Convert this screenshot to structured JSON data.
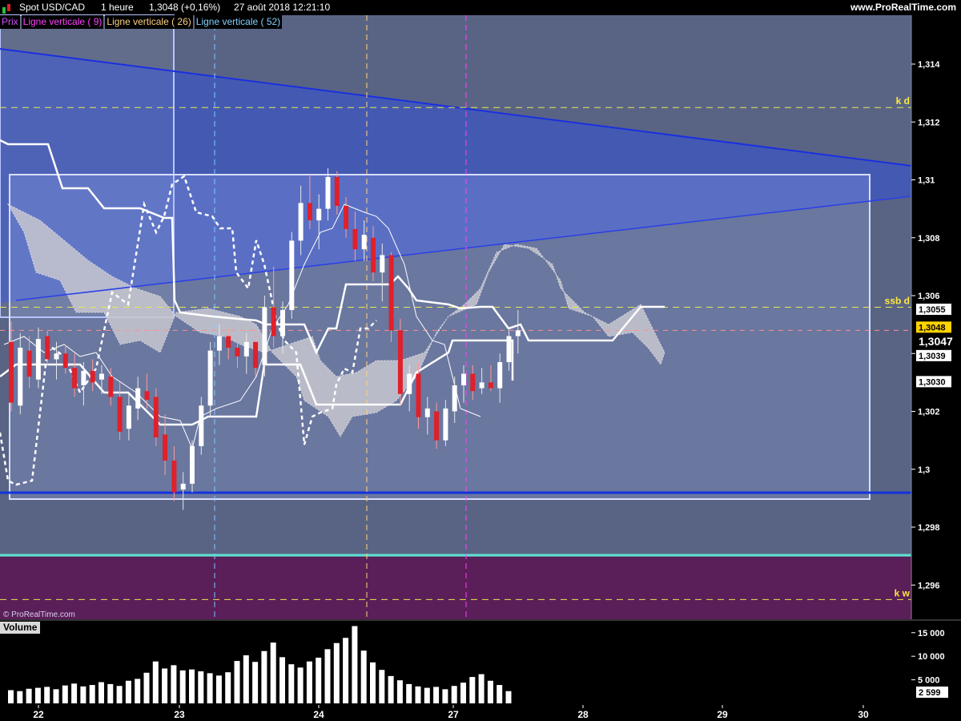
{
  "header": {
    "instrument": "Spot USD/CAD",
    "timeframe": "1 heure",
    "last_change": "1,3048 (+0,16%)",
    "datetime": "27 août 2018 12:21:10",
    "site": "www.ProRealTime.com"
  },
  "legend": [
    {
      "label": "Prix",
      "color": "#d050ff"
    },
    {
      "label": "Ligne verticale ( 9)",
      "color": "#ff40ff"
    },
    {
      "label": "Ligne verticale ( 26)",
      "color": "#ffd080"
    },
    {
      "label": "Ligne verticale ( 52)",
      "color": "#80d0ff"
    }
  ],
  "watermark": "© ProRealTime.com",
  "volume_panel": {
    "label": "Volume",
    "axis_labels": [
      "15 000",
      "10 000",
      "5 000",
      "2 599"
    ],
    "last_value_label": "2 599"
  },
  "price_labels": [
    {
      "text": "k d",
      "level": 1.3125
    },
    {
      "text": "ssb d",
      "level": 1.3056
    },
    {
      "text": "k w",
      "level": 1.2955
    }
  ],
  "price_tags": [
    {
      "text": "1,3055",
      "value": 1.3055,
      "bg": "#ffffff",
      "fg": "#000000"
    },
    {
      "text": "1,3048",
      "value": 1.3048,
      "bg": "#ffd400",
      "fg": "#000000"
    },
    {
      "text": "1,3047",
      "value": 1.3047,
      "bg": "#000000",
      "fg": "#ffffff"
    },
    {
      "text": "1,3039",
      "value": 1.3039,
      "bg": "#ffffff",
      "fg": "#000000"
    },
    {
      "text": "1,3030",
      "value": 1.303,
      "bg": "#ffffff",
      "fg": "#000000"
    }
  ],
  "colors": {
    "background": "#000000",
    "chart_bg": "#596485",
    "bull_candle": "#ffffff",
    "bear_candle": "#e0202a",
    "trendline": "#1a2fe0",
    "cloud": "#c8c8d0",
    "horizontal_cyan": "#60e0d0",
    "lower_zone": "#5a1e58",
    "dash_yellow": "#e8e850"
  },
  "chart_data": [
    {
      "type": "candlestick",
      "title": "Spot USD/CAD",
      "timeframe": "1 heure",
      "x_tick_labels": [
        "22",
        "23",
        "24",
        "27",
        "28",
        "29",
        "30"
      ],
      "y_tick_labels": [
        "1,296",
        "1,298",
        "1,3",
        "1,302",
        "1,304",
        "1,306",
        "1,308",
        "1,31",
        "1,312",
        "1,314"
      ],
      "ylim": [
        1.295,
        1.3155
      ],
      "grid": false,
      "ohlc": [
        [
          1.3044,
          1.3051,
          1.302,
          1.3023
        ],
        [
          1.3022,
          1.3047,
          1.3019,
          1.3042
        ],
        [
          1.3041,
          1.3046,
          1.3028,
          1.3032
        ],
        [
          1.3031,
          1.3049,
          1.3028,
          1.3045
        ],
        [
          1.3046,
          1.3048,
          1.3036,
          1.3038
        ],
        [
          1.3038,
          1.3044,
          1.3031,
          1.304
        ],
        [
          1.304,
          1.3043,
          1.3033,
          1.3035
        ],
        [
          1.3035,
          1.304,
          1.3025,
          1.3028
        ],
        [
          1.3029,
          1.3037,
          1.3022,
          1.3034
        ],
        [
          1.3034,
          1.3038,
          1.3027,
          1.303
        ],
        [
          1.3031,
          1.3036,
          1.3026,
          1.3033
        ],
        [
          1.3032,
          1.3035,
          1.3022,
          1.3025
        ],
        [
          1.3025,
          1.303,
          1.301,
          1.3013
        ],
        [
          1.3014,
          1.3026,
          1.301,
          1.3022
        ],
        [
          1.3021,
          1.3032,
          1.3017,
          1.3028
        ],
        [
          1.3027,
          1.3033,
          1.3021,
          1.3024
        ],
        [
          1.3025,
          1.3028,
          1.3008,
          1.3011
        ],
        [
          1.3012,
          1.3019,
          1.2998,
          1.3003
        ],
        [
          1.3003,
          1.3008,
          1.2989,
          1.2992
        ],
        [
          1.2993,
          1.2999,
          1.2986,
          1.2995
        ],
        [
          1.2995,
          1.301,
          1.2992,
          1.3008
        ],
        [
          1.3008,
          1.3025,
          1.3005,
          1.3022
        ],
        [
          1.3022,
          1.3044,
          1.3018,
          1.3041
        ],
        [
          1.3041,
          1.305,
          1.3036,
          1.3046
        ],
        [
          1.3046,
          1.3049,
          1.3038,
          1.3042
        ],
        [
          1.3042,
          1.3046,
          1.3035,
          1.3039
        ],
        [
          1.3039,
          1.3047,
          1.3033,
          1.3044
        ],
        [
          1.3044,
          1.3048,
          1.3032,
          1.3035
        ],
        [
          1.3036,
          1.306,
          1.3032,
          1.3056
        ],
        [
          1.3056,
          1.307,
          1.3042,
          1.3046
        ],
        [
          1.3046,
          1.3058,
          1.304,
          1.3055
        ],
        [
          1.3055,
          1.3082,
          1.3052,
          1.3079
        ],
        [
          1.3079,
          1.3098,
          1.3074,
          1.3092
        ],
        [
          1.3092,
          1.3102,
          1.3083,
          1.3086
        ],
        [
          1.3086,
          1.3095,
          1.3076,
          1.309
        ],
        [
          1.309,
          1.3104,
          1.3086,
          1.3101
        ],
        [
          1.3101,
          1.3103,
          1.3088,
          1.3091
        ],
        [
          1.3091,
          1.3094,
          1.308,
          1.3083
        ],
        [
          1.3083,
          1.3089,
          1.3072,
          1.3076
        ],
        [
          1.3076,
          1.3086,
          1.3072,
          1.3081
        ],
        [
          1.308,
          1.3084,
          1.3065,
          1.3068
        ],
        [
          1.3068,
          1.3078,
          1.3058,
          1.3074
        ],
        [
          1.3074,
          1.3075,
          1.3044,
          1.3048
        ],
        [
          1.3048,
          1.3052,
          1.3022,
          1.3026
        ],
        [
          1.3026,
          1.3036,
          1.302,
          1.3033
        ],
        [
          1.3033,
          1.3037,
          1.3014,
          1.3018
        ],
        [
          1.3018,
          1.3025,
          1.3012,
          1.3021
        ],
        [
          1.302,
          1.3023,
          1.3007,
          1.301
        ],
        [
          1.301,
          1.3024,
          1.3008,
          1.3021
        ],
        [
          1.302,
          1.3032,
          1.3016,
          1.3029
        ],
        [
          1.3029,
          1.3036,
          1.3023,
          1.3033
        ],
        [
          1.3033,
          1.3036,
          1.3024,
          1.3027
        ],
        [
          1.3028,
          1.3035,
          1.3026,
          1.303
        ],
        [
          1.303,
          1.3036,
          1.3027,
          1.3028
        ],
        [
          1.3028,
          1.304,
          1.3023,
          1.3037
        ],
        [
          1.3037,
          1.3048,
          1.3034,
          1.3046
        ],
        [
          1.3046,
          1.3055,
          1.304,
          1.3048
        ]
      ],
      "volume": [
        2800,
        2600,
        3100,
        3300,
        3500,
        3000,
        3800,
        4200,
        3600,
        3900,
        4500,
        4100,
        3700,
        4800,
        5200,
        6500,
        8900,
        7400,
        8100,
        7000,
        7200,
        6800,
        6400,
        5900,
        6600,
        9000,
        10200,
        8800,
        11100,
        12900,
        9800,
        8300,
        7600,
        8900,
        9700,
        11500,
        12800,
        13900,
        16400,
        11200,
        8700,
        7100,
        5800,
        4900,
        4100,
        3600,
        3300,
        3500,
        3000,
        3700,
        4400,
        5600,
        6200,
        4800,
        3900,
        2599
      ]
    }
  ]
}
